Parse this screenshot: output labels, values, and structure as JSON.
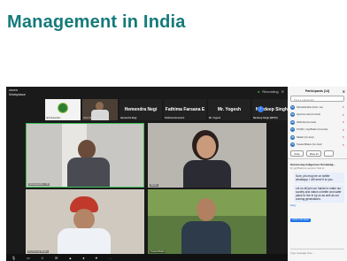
{
  "slide": {
    "title": "Management in India"
  },
  "app": {
    "brand_line1": "zoom",
    "brand_line2": "Workplace",
    "recording": "Recording"
  },
  "strip": {
    "thumbs": [
      {
        "label": "Sphotebandhu"
      },
      {
        "label": "Harsh Bhardwaj"
      },
      {
        "name": "Hemendra Negi",
        "label": "Hemendra Negi"
      },
      {
        "name": "Fathima Farsana E",
        "label": "Fathima Farsana E"
      },
      {
        "name": "Mr. Yogesh",
        "label": "Mr. Yogesh"
      },
      {
        "name": "Navdeep Singh...",
        "label": "Navdeep Singh (MOTA)"
      }
    ]
  },
  "tiles": [
    {
      "label": "Sphotebandhu - VR"
    },
    {
      "label": "Nikitah"
    },
    {
      "label": "Dr.(VG) Jog Bhakru"
    },
    {
      "label": "Tiewas Bhakru"
    }
  ],
  "participants": {
    "header": "Participants (14)",
    "search_placeholder": "Find a participant",
    "rows": [
      {
        "initials": "SV",
        "name": "Sphotebandhu (Host, me)"
      },
      {
        "initials": "AR",
        "name": "Apoorva Lata (Co-host)"
      },
      {
        "initials": "NR",
        "name": "Nidhi Rai (Co-host)"
      },
      {
        "initials": "PJ",
        "name": "Prof(Dr.) Jog Bhakru (Co-host)"
      },
      {
        "initials": "NB",
        "name": "Nikitah (Co-host)"
      },
      {
        "initials": "TB",
        "name": "Tiewas Bhakru (Co-host)"
      }
    ],
    "invite_label": "Invite",
    "mute_all_label": "Mute all",
    "more_label": "..."
  },
  "chat": {
    "header": "Harnessing Indigenous Knowledg...",
    "subtitle": "Dr. jog Bhakru to everyone: Hello sir",
    "message_1": "Sure, pls msg me on twitter whatsapp. I will send it to you.",
    "message_2": "Let us all join our hands to make our society and nation a better and safer place to live in by us as well as our coming generations.",
    "reply_label": "Reply",
    "new_message_label": "Jump to the latest",
    "input_placeholder": "Type message here..."
  },
  "toolbar": {
    "items": [
      "Mute",
      "Video",
      "Participants",
      "Chat",
      "Share",
      "Record",
      "Reactions",
      "More"
    ]
  }
}
